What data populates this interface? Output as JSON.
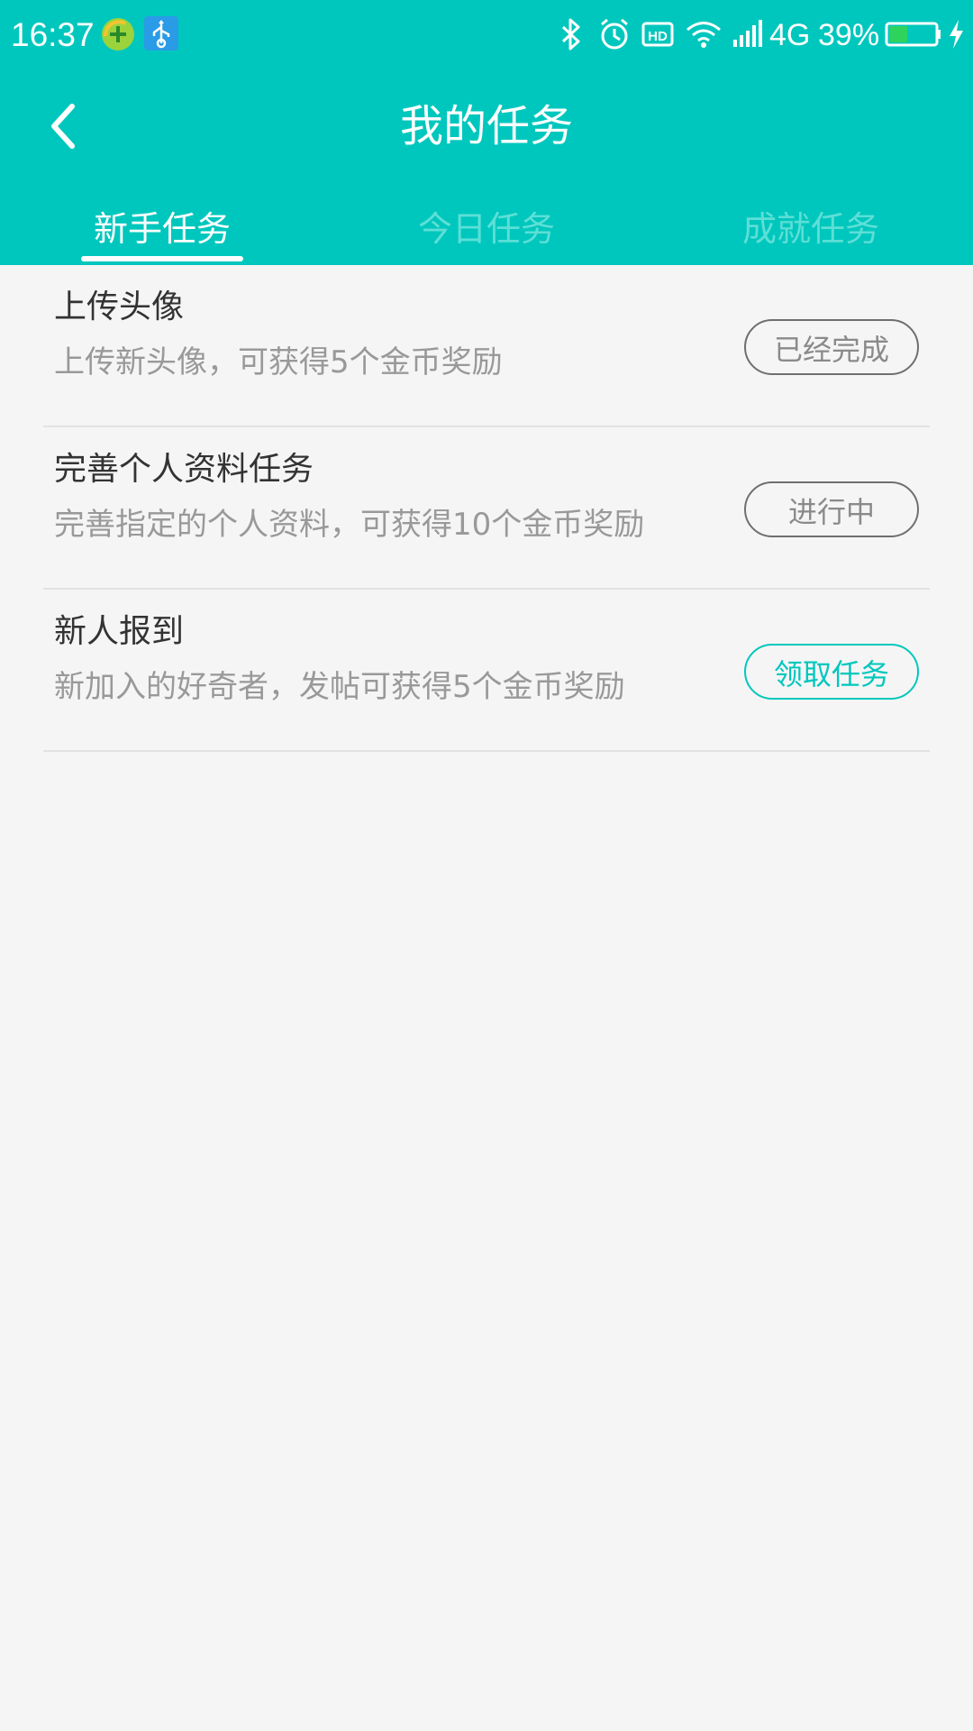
{
  "status_bar": {
    "time": "16:37",
    "network": "4G",
    "battery_percent": "39%",
    "battery_level": 0.39,
    "icons": [
      "app-notification-icon",
      "usb-icon",
      "bluetooth-icon",
      "alarm-icon",
      "hd-icon",
      "wifi-icon",
      "signal-icon",
      "battery-icon",
      "charging-icon"
    ]
  },
  "header": {
    "title": "我的任务",
    "background_color": "#00c7bd"
  },
  "tabs": [
    {
      "label": "新手任务",
      "active": true
    },
    {
      "label": "今日任务",
      "active": false
    },
    {
      "label": "成就任务",
      "active": false
    }
  ],
  "tasks": [
    {
      "title": "上传头像",
      "description": "上传新头像，可获得5个金币奖励",
      "button": "已经完成"
    },
    {
      "title": "完善个人资料任务",
      "description": "完善指定的个人资料，可获得10个金币奖励",
      "button": "进行中"
    },
    {
      "title": "新人报到",
      "description": "新加入的好奇者，发帖可获得5个金币奖励",
      "button": "领取任务"
    }
  ],
  "colors": {
    "accent": "#00c7bd",
    "page_background": "#f5f5f5"
  }
}
